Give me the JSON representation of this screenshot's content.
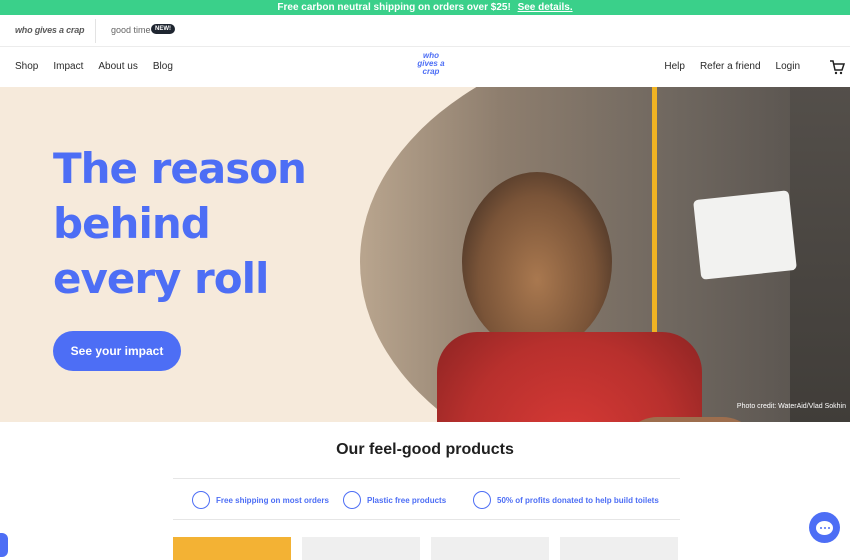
{
  "promo": {
    "text": "Free carbon neutral shipping on orders over $25!",
    "link": "See details."
  },
  "brands": {
    "primary": "who gives a crap",
    "secondary": "good time",
    "badge": "NEW!"
  },
  "nav": {
    "left": [
      "Shop",
      "Impact",
      "About us",
      "Blog"
    ],
    "right": [
      "Help",
      "Refer a friend",
      "Login"
    ],
    "logo": "who gives a crap"
  },
  "hero": {
    "title": "The reason behind every roll",
    "cta": "See your impact",
    "credit": "Photo credit: WaterAid/Vlad Sokhin"
  },
  "products": {
    "title": "Our feel-good products",
    "features": [
      "Free shipping on most orders",
      "Plastic free products",
      "50% of profits donated to help build toilets"
    ]
  },
  "colors": {
    "accent": "#4d6ef5",
    "promo": "#3ad08a",
    "hero_bg": "#f6eadb"
  }
}
